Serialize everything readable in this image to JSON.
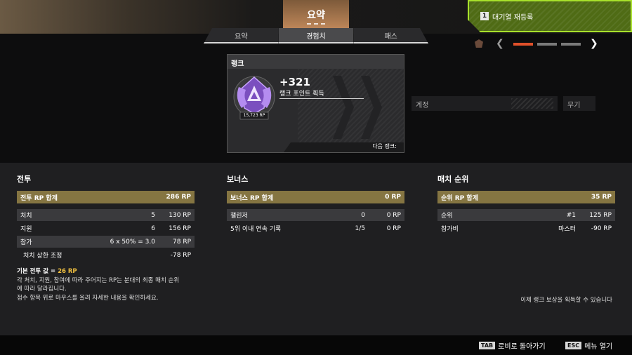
{
  "header": {
    "title": "요약",
    "tabs": [
      {
        "label": "요약",
        "active": false
      },
      {
        "label": "경험치",
        "active": true
      },
      {
        "label": "패스",
        "active": false
      }
    ]
  },
  "requeue": {
    "key": "1",
    "label": "대기열 재등록"
  },
  "pager": {
    "current_page": 1,
    "total_pages": 3
  },
  "rank_card": {
    "title": "랭크",
    "badge_rp": "15,723 RP",
    "gain": "+321",
    "gain_label": "랭크 포인트 획득",
    "next_rank_label": "다음 랭크:"
  },
  "side": {
    "account": "계정",
    "weapon": "무기"
  },
  "combat": {
    "title": "전투",
    "total_label": "전투 RP 합계",
    "total_value": "286 RP",
    "rows": [
      {
        "label": "처치",
        "count": "5",
        "value": "130 RP"
      },
      {
        "label": "지원",
        "count": "6",
        "value": "156 RP"
      },
      {
        "label": "참가",
        "count": "6 x 50% = 3.0",
        "value": "78 RP"
      },
      {
        "label": "처치 상한 조정",
        "count": "",
        "value": "-78 RP"
      }
    ]
  },
  "bonus": {
    "title": "보너스",
    "total_label": "보너스 RP 합계",
    "total_value": "0 RP",
    "rows": [
      {
        "label": "챌린저",
        "count": "0",
        "value": "0 RP"
      },
      {
        "label": "5위 이내 연속 기록",
        "count": "1/5",
        "value": "0 RP"
      }
    ]
  },
  "placement": {
    "title": "매치 순위",
    "total_label": "순위 RP 합계",
    "total_value": "35 RP",
    "rows": [
      {
        "label": "순위",
        "count": "#1",
        "value": "125 RP"
      },
      {
        "label": "참가비",
        "count": "마스터",
        "value": "-90 RP"
      }
    ]
  },
  "notes": {
    "base_label": "기본 전투 값 = ",
    "base_value": "26 RP",
    "line1": "각 처치, 지원, 참여에 따라 주어지는 RP는 분대의 최종 매치 순위",
    "line2": "에 따라 달라집니다.",
    "line3": "점수 항목 위로 마우스를 올려 자세한 내용을 확인하세요."
  },
  "earn_note": "이제 랭크 보상을 획득할 수 있습니다",
  "footer": {
    "tab_key": "TAB",
    "tab_label": "로비로 돌아가기",
    "esc_key": "ESC",
    "esc_label": "메뉴 열기"
  },
  "colors": {
    "accent_gold": "#857542",
    "requeue_green": "#a8e12b",
    "pager_active": "#e0502a",
    "rank_purple": "#9b6fd6"
  }
}
